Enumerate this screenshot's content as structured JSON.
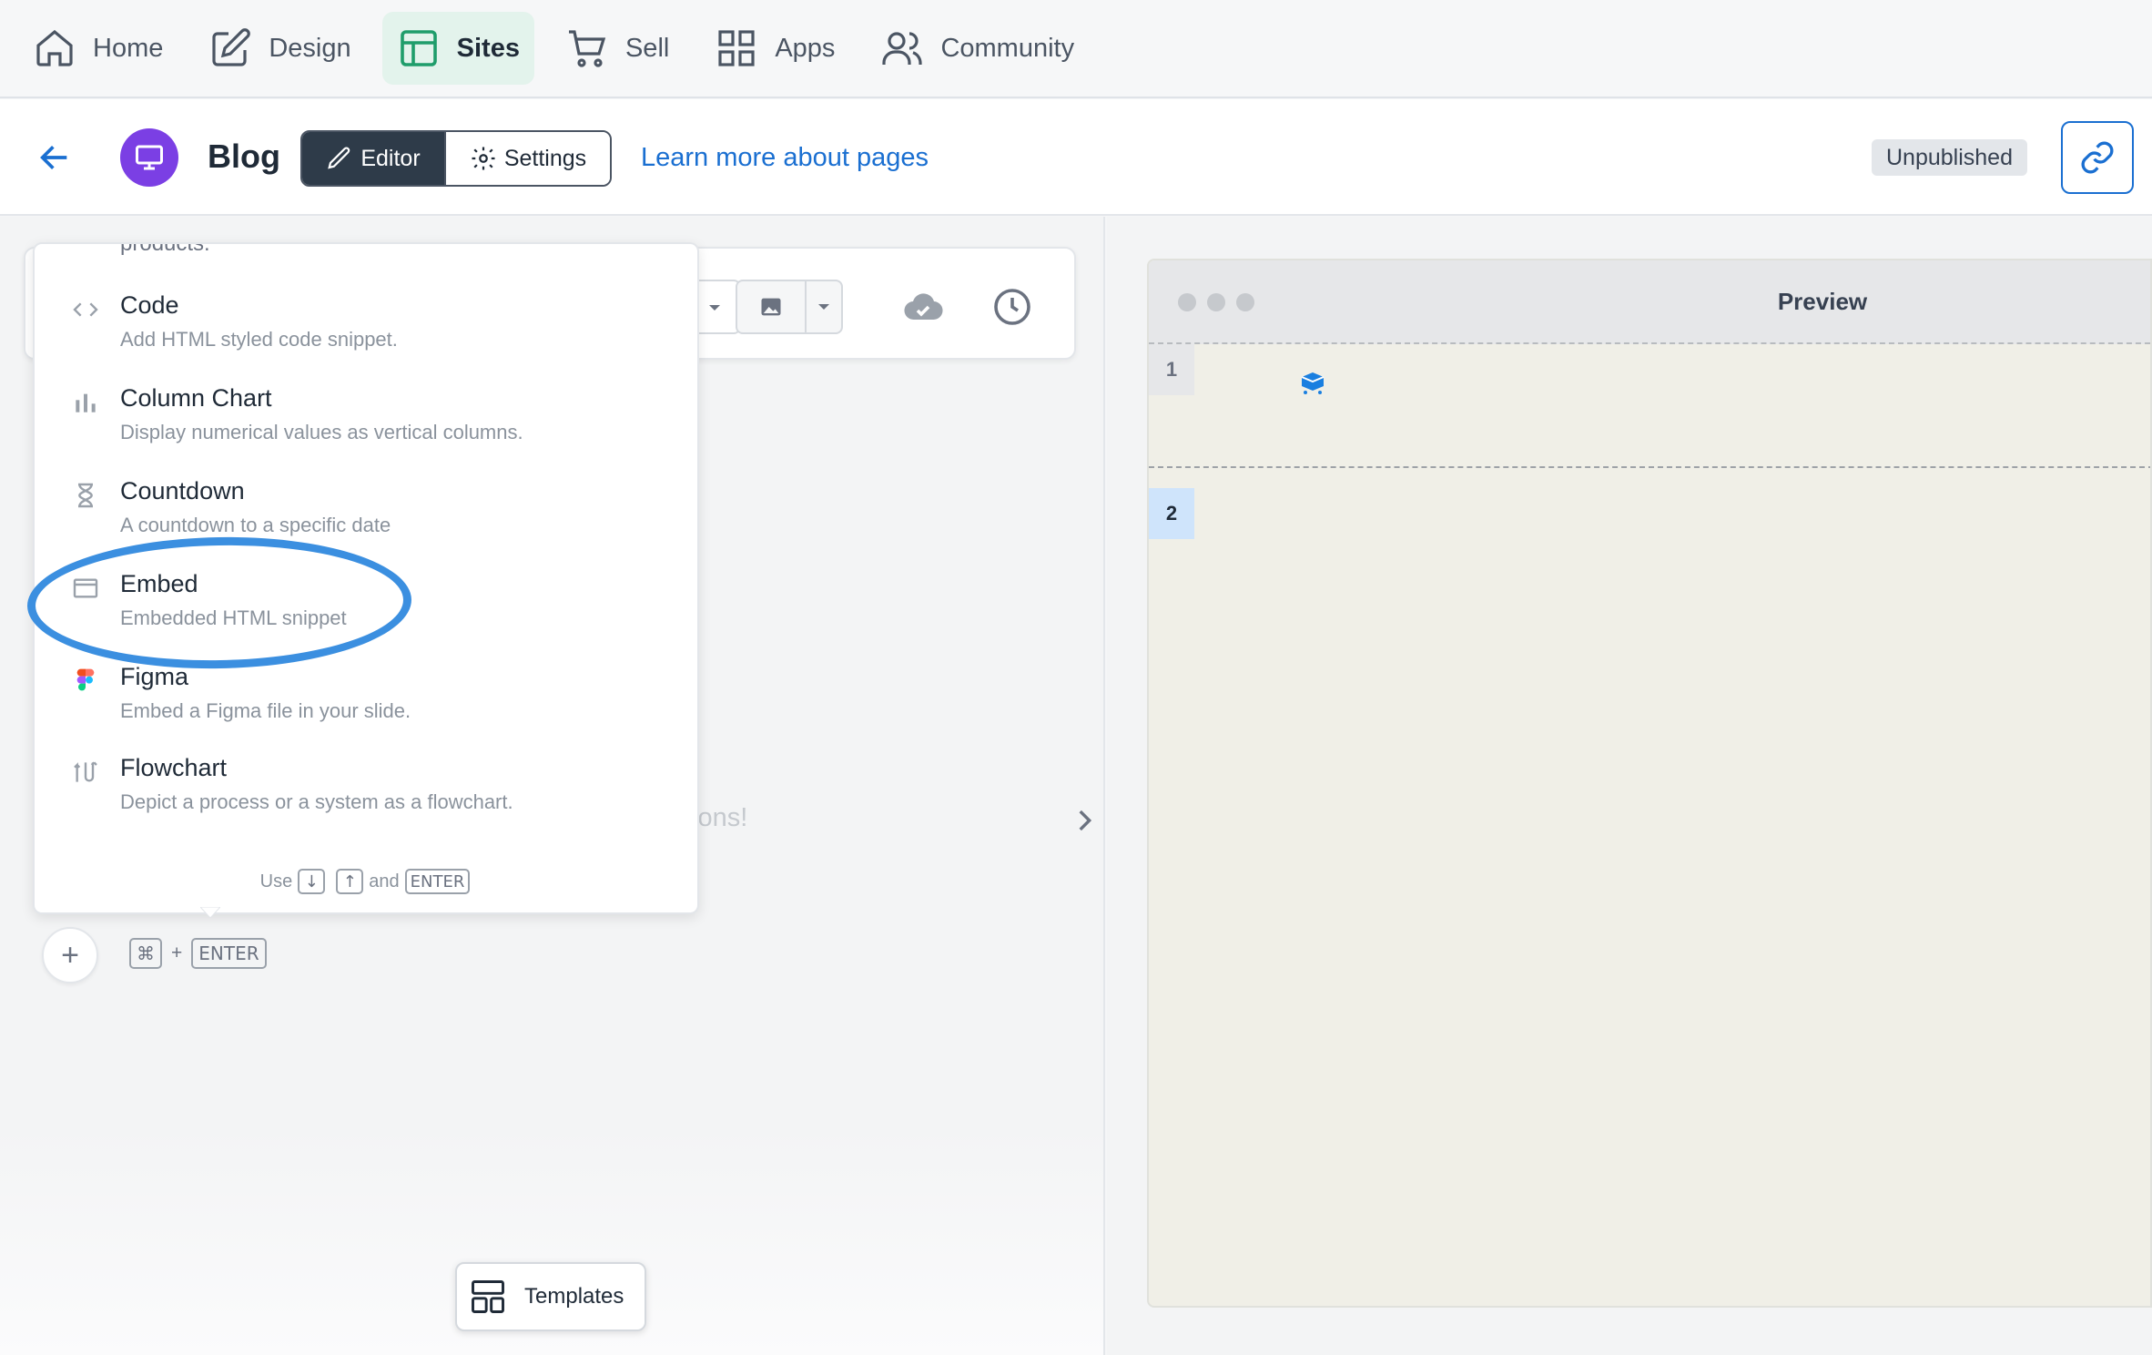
{
  "topnav": {
    "items": [
      {
        "label": "Home",
        "icon": "home-icon"
      },
      {
        "label": "Design",
        "icon": "pencil-square-icon"
      },
      {
        "label": "Sites",
        "icon": "layout-icon",
        "active": true
      },
      {
        "label": "Sell",
        "icon": "cart-icon"
      },
      {
        "label": "Apps",
        "icon": "grid-icon"
      },
      {
        "label": "Community",
        "icon": "users-icon"
      }
    ]
  },
  "header": {
    "title": "Blog",
    "editor_label": "Editor",
    "settings_label": "Settings",
    "learn_link": "Learn more about pages",
    "status": "Unpublished"
  },
  "menu": {
    "cut_item": "products.",
    "items": [
      {
        "title": "Code",
        "desc": "Add HTML styled code snippet.",
        "icon": "code-icon"
      },
      {
        "title": "Column Chart",
        "desc": "Display numerical values as vertical columns.",
        "icon": "bar-chart-icon"
      },
      {
        "title": "Countdown",
        "desc": "A countdown to a specific date",
        "icon": "hourglass-icon"
      },
      {
        "title": "Embed",
        "desc": "Embedded HTML snippet",
        "icon": "window-icon",
        "highlighted": true
      },
      {
        "title": "Figma",
        "desc": "Embed a Figma file in your slide.",
        "icon": "figma-icon"
      },
      {
        "title": "Flowchart",
        "desc": "Depict a process or a system as a flowchart.",
        "icon": "flowchart-icon"
      }
    ],
    "footer": {
      "use": "Use",
      "down": "↓",
      "up": "↑",
      "and": "and",
      "enter": "ENTER"
    }
  },
  "editor": {
    "hint_partial": "tions!",
    "shortcut_cmd": "⌘",
    "shortcut_plus": "+",
    "shortcut_enter": "ENTER",
    "add_symbol": "+",
    "templates_label": "Templates"
  },
  "preview": {
    "title": "Preview",
    "rows": [
      "1",
      "2"
    ]
  },
  "colors": {
    "accent": "#1a6fd1",
    "sites_active_bg": "#e3f3ec",
    "avatar": "#7b3fe4",
    "highlight_ring": "#3b8fe0",
    "preview_bg": "#f0efe7"
  }
}
